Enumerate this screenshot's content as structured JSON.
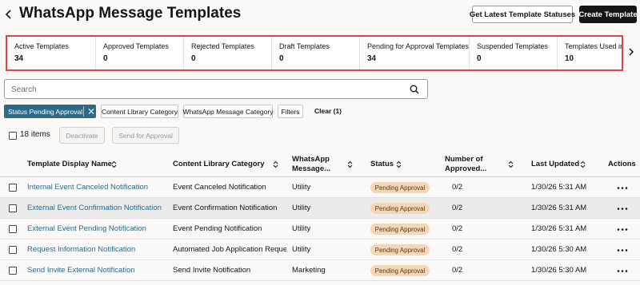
{
  "header": {
    "title": "WhatsApp Message Templates",
    "get_statuses_label": "Get Latest Template Statuses",
    "create_label": "Create Template"
  },
  "metrics": [
    {
      "label": "Active Templates",
      "value": "34"
    },
    {
      "label": "Approved Templates",
      "value": "0"
    },
    {
      "label": "Rejected Templates",
      "value": "0"
    },
    {
      "label": "Draft Templates",
      "value": "0"
    },
    {
      "label": "Pending for Approval Templates",
      "value": "34"
    },
    {
      "label": "Suspended Templates",
      "value": "0"
    },
    {
      "label": "Templates Used in Co",
      "value": "10"
    }
  ],
  "search": {
    "placeholder": "Search",
    "value": ""
  },
  "filters": {
    "active_chip": "Status Pending Approval",
    "chips": [
      "Content Library Category",
      "WhatsApp Message Category",
      "Filters"
    ],
    "clear_label": "Clear (1)"
  },
  "bulk": {
    "count_label": "18 items",
    "deactivate_label": "Deactivate",
    "send_label": "Send for Approval"
  },
  "table": {
    "columns": {
      "name": "Template Display Name",
      "category": "Content Library Category",
      "wa_line1": "WhatsApp",
      "wa_line2": "Message...",
      "status": "Status",
      "approved_line1": "Number of",
      "approved_line2": "Approved...",
      "updated": "Last Updated",
      "actions": "Actions"
    },
    "rows": [
      {
        "name": "Internal Event Canceled Notification",
        "category": "Event Canceled Notification",
        "wa_category": "Utility",
        "status": "Pending Approval",
        "approved": "0/2",
        "updated": "1/30/26 5:31 AM"
      },
      {
        "name": "External Event Confirmation Notification",
        "category": "Event Confirmation Notification",
        "wa_category": "Utility",
        "status": "Pending Approval",
        "approved": "0/2",
        "updated": "1/30/26 5:31 AM"
      },
      {
        "name": "External Event Pending Notification",
        "category": "Event Pending Notification",
        "wa_category": "Utility",
        "status": "Pending Approval",
        "approved": "0/2",
        "updated": "1/30/26 5:31 AM"
      },
      {
        "name": "Request Information Notification",
        "category": "Automated Job Application Reques",
        "wa_category": "Utility",
        "status": "Pending Approval",
        "approved": "0/2",
        "updated": "1/30/26 5:30 AM"
      },
      {
        "name": "Send Invite External Notification",
        "category": "Send Invite Notification",
        "wa_category": "Marketing",
        "status": "Pending Approval",
        "approved": "0/2",
        "updated": "1/30/26 5:30 AM"
      }
    ]
  },
  "colors": {
    "accent": "#2b6a88",
    "primary_button": "#161513",
    "highlight_border": "#e04347",
    "pending_badge": "#f4d7b8"
  },
  "icons": [
    "back-arrow-icon",
    "search-icon",
    "close-icon",
    "sort-icon",
    "more-actions-icon",
    "chevron-right-icon"
  ]
}
